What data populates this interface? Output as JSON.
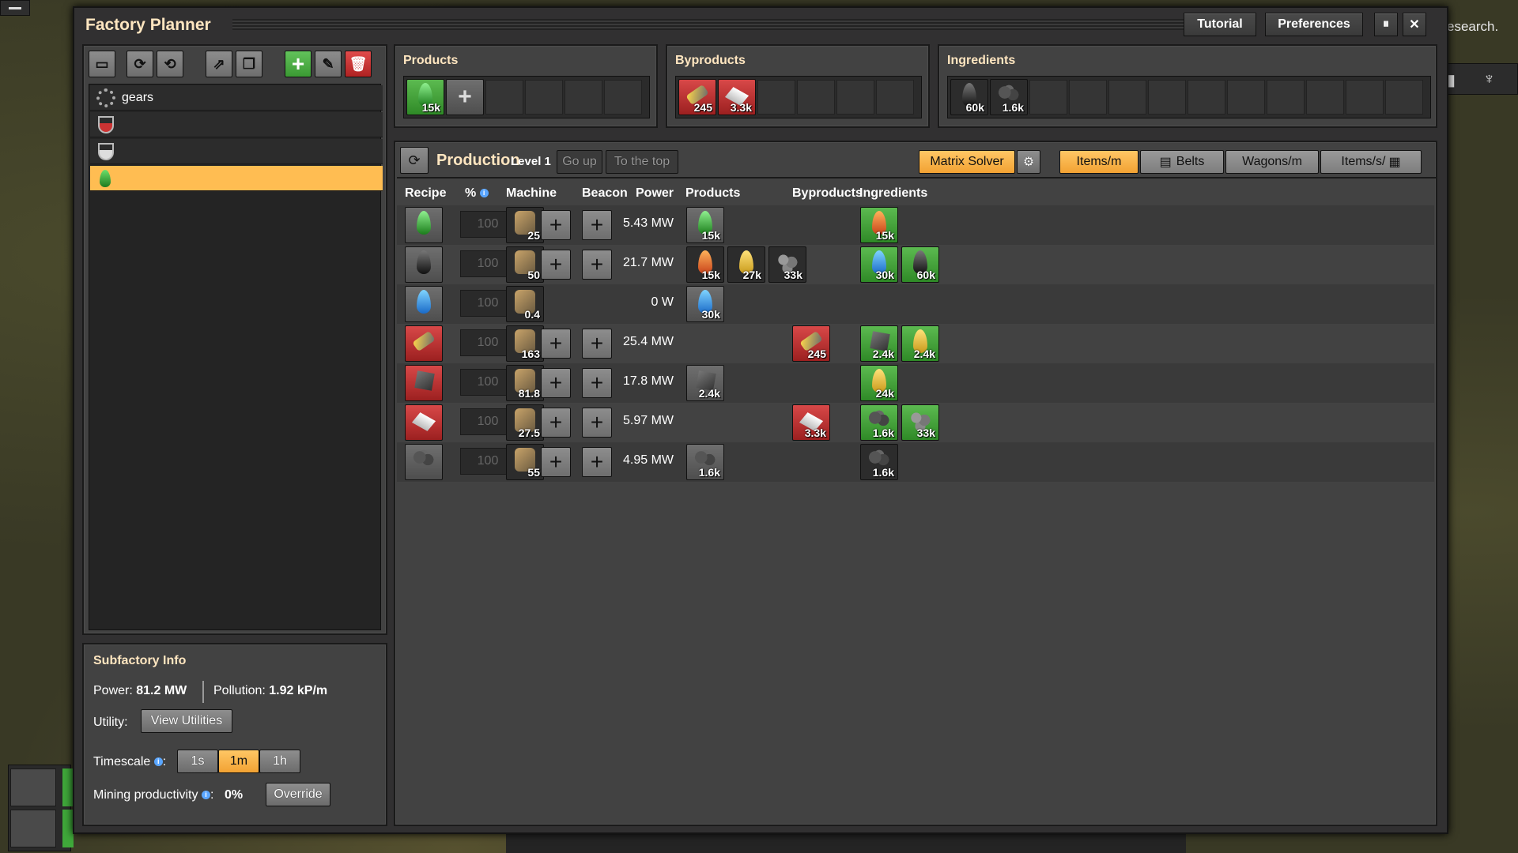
{
  "window": {
    "title": "Factory Planner",
    "tutorial_label": "Tutorial",
    "preferences_label": "Preferences",
    "pause_glyph": "⏸",
    "close_glyph": "✕"
  },
  "background": {
    "research_text": "esearch."
  },
  "subfactories": [
    {
      "label": "gears",
      "icon": "gear-icon"
    },
    {
      "label": "",
      "icon": "red-science-flask-icon"
    },
    {
      "label": "",
      "icon": "white-science-flask-icon"
    },
    {
      "label": "",
      "icon": "green-drop-icon",
      "selected": true
    }
  ],
  "products_panel": {
    "title": "Products",
    "items": [
      {
        "icon": "green-drop",
        "count": "15k"
      }
    ]
  },
  "byproducts_panel": {
    "title": "Byproducts",
    "items": [
      {
        "icon": "barrel",
        "count": "245"
      },
      {
        "icon": "plate",
        "count": "3.3k"
      }
    ]
  },
  "ingredients_panel": {
    "title": "Ingredients",
    "items": [
      {
        "icon": "black-drop",
        "count": "60k"
      },
      {
        "icon": "coal",
        "count": "1.6k"
      }
    ]
  },
  "production": {
    "title": "Production",
    "level": "Level 1",
    "go_up": "Go up",
    "to_top": "To the top",
    "solver": "Matrix Solver",
    "units": [
      "Items/m",
      "Belts",
      "Wagons/m",
      "Items/s/"
    ],
    "active_unit": "Items/m",
    "headers": {
      "recipe": "Recipe",
      "pct": "%",
      "machine": "Machine",
      "beacon": "Beacon",
      "power": "Power",
      "products": "Products",
      "byproducts": "Byproducts",
      "ingredients": "Ingredients"
    }
  },
  "rows": [
    {
      "recipe": "drop-g",
      "recipe_color": "grey",
      "pct": "100",
      "machine": "25",
      "has_buttons": true,
      "power": "5.43 MW",
      "products": [
        {
          "i": "drop-g",
          "n": "15k",
          "c": "grey"
        }
      ],
      "byproducts": [],
      "ingredients": [
        {
          "i": "drop-o",
          "n": "15k",
          "c": "green"
        }
      ]
    },
    {
      "recipe": "drop-k",
      "recipe_color": "grey",
      "pct": "100",
      "machine": "50",
      "has_buttons": true,
      "power": "21.7 MW",
      "products": [
        {
          "i": "drop-o",
          "n": "15k",
          "c": "dark"
        },
        {
          "i": "drop-y",
          "n": "27k",
          "c": "dark"
        },
        {
          "i": "ore",
          "n": "33k",
          "c": "dark"
        }
      ],
      "byproducts": [],
      "ingredients": [
        {
          "i": "drop-b",
          "n": "30k",
          "c": "green"
        },
        {
          "i": "drop-k",
          "n": "60k",
          "c": "green"
        }
      ]
    },
    {
      "recipe": "drop-b",
      "recipe_color": "grey",
      "pct": "100",
      "machine": "0.4",
      "has_buttons": false,
      "power": "0 W",
      "products": [
        {
          "i": "drop-b",
          "n": "30k",
          "c": "grey"
        }
      ],
      "byproducts": [],
      "ingredients": []
    },
    {
      "recipe": "barrel",
      "recipe_color": "red",
      "pct": "100",
      "machine": "163",
      "has_buttons": true,
      "power": "25.4 MW",
      "products": [],
      "byproducts": [
        {
          "i": "barrel",
          "n": "245",
          "c": "red"
        }
      ],
      "ingredients": [
        {
          "i": "block",
          "n": "2.4k",
          "c": "green"
        },
        {
          "i": "drop-y",
          "n": "2.4k",
          "c": "green"
        }
      ]
    },
    {
      "recipe": "block",
      "recipe_color": "red",
      "pct": "100",
      "machine": "81.8",
      "has_buttons": true,
      "power": "17.8 MW",
      "products": [
        {
          "i": "block",
          "n": "2.4k",
          "c": "grey"
        }
      ],
      "byproducts": [],
      "ingredients": [
        {
          "i": "drop-y",
          "n": "24k",
          "c": "green"
        }
      ]
    },
    {
      "recipe": "plate",
      "recipe_color": "red",
      "pct": "100",
      "machine": "27.5",
      "has_buttons": true,
      "power": "5.97 MW",
      "products": [],
      "byproducts": [
        {
          "i": "plate",
          "n": "3.3k",
          "c": "red"
        }
      ],
      "ingredients": [
        {
          "i": "coal",
          "n": "1.6k",
          "c": "green"
        },
        {
          "i": "ore",
          "n": "33k",
          "c": "green"
        }
      ]
    },
    {
      "recipe": "coal",
      "recipe_color": "grey",
      "pct": "100",
      "machine": "55",
      "has_buttons": true,
      "power": "4.95 MW",
      "products": [
        {
          "i": "coal",
          "n": "1.6k",
          "c": "grey"
        }
      ],
      "byproducts": [],
      "ingredients": [
        {
          "i": "coal",
          "n": "1.6k",
          "c": "dark"
        }
      ]
    }
  ],
  "subfactory_info": {
    "title": "Subfactory Info",
    "power_label": "Power:",
    "power_value": "81.2 MW",
    "pollution_label": "Pollution:",
    "pollution_value": "1.92 kP/m",
    "utility_label": "Utility:",
    "view_utilities": "View Utilities",
    "timescale_label": "Timescale",
    "timescales": [
      "1s",
      "1m",
      "1h"
    ],
    "active_timescale": "1m",
    "mining_label": "Mining productivity",
    "mining_value": "0%",
    "override_label": "Override"
  },
  "hud": {
    "count": "2"
  }
}
